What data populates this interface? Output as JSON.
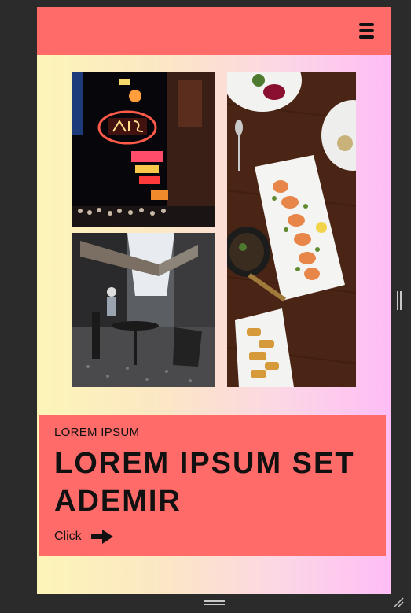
{
  "menu": {
    "icon": "hamburger-menu-icon"
  },
  "gallery": {
    "images": [
      {
        "name": "stage-neon-sign-street-photo"
      },
      {
        "name": "cafe-alley-outdoor-seating-photo"
      },
      {
        "name": "shrimp-platter-dinner-table-photo"
      }
    ]
  },
  "card": {
    "eyebrow": "LOREM IPSUM",
    "headline": "LOREM IPSUM SET ADEMIR",
    "cta_label": "Click",
    "cta_icon": "right-arrow-icon"
  },
  "colors": {
    "accent": "#ff6b68",
    "gradient_start": "#fdf5b8",
    "gradient_end": "#ffbdf5"
  }
}
